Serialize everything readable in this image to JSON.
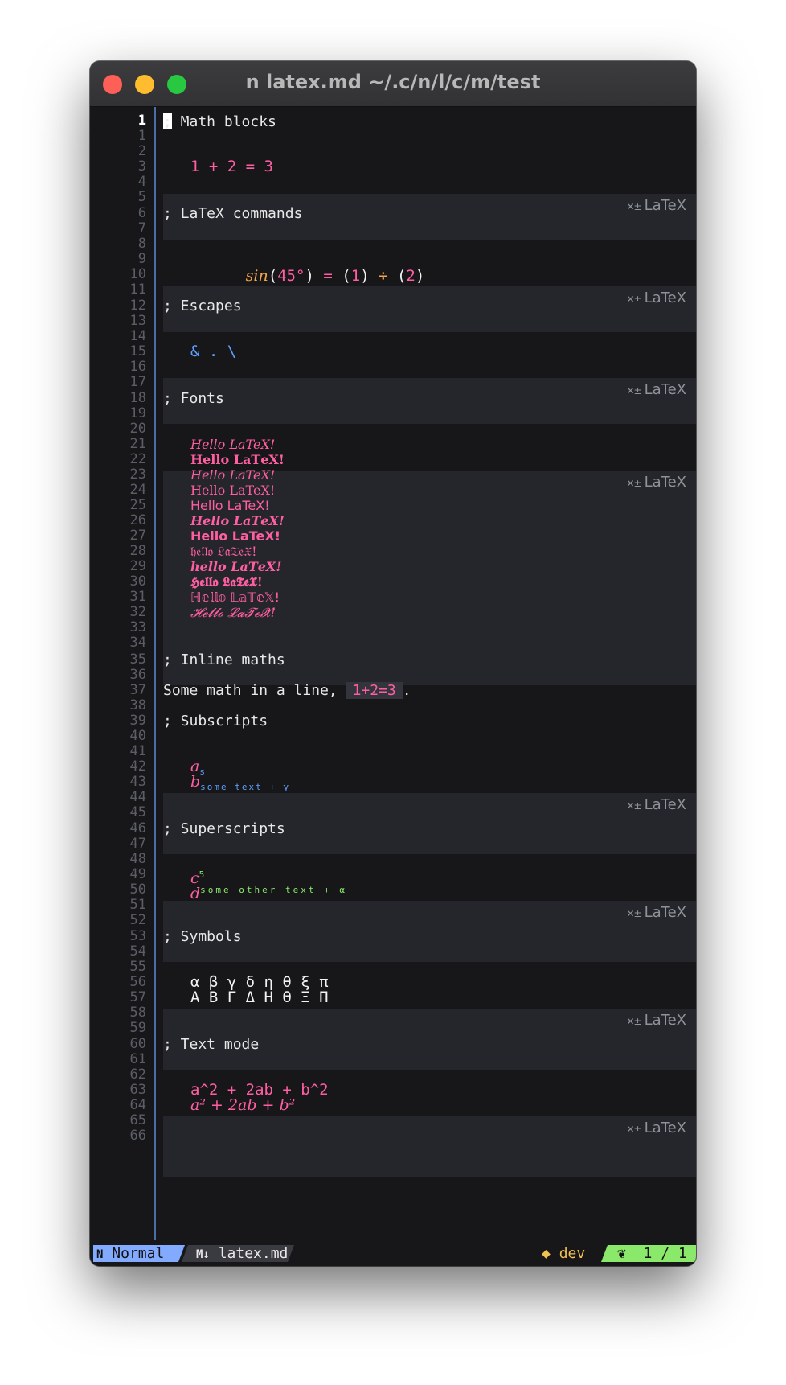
{
  "window": {
    "title": "n latex.md ~/.c/n/l/c/m/test"
  },
  "editor": {
    "line_numbers": [
      "1",
      "1",
      "2",
      "3",
      "4",
      "5",
      "6",
      "7",
      "8",
      "9",
      "10",
      "11",
      "12",
      "13",
      "14",
      "15",
      "16",
      "17",
      "18",
      "19",
      "20",
      "21",
      "22",
      "23",
      "24",
      "25",
      "26",
      "27",
      "28",
      "29",
      "30",
      "31",
      "32",
      "33",
      "34",
      "35",
      "36",
      "37",
      "38",
      "39",
      "40",
      "41",
      "42",
      "43",
      "44",
      "45",
      "46",
      "47",
      "48",
      "49",
      "50",
      "51",
      "52",
      "53",
      "54",
      "55",
      "56",
      "57",
      "58",
      "59",
      "60",
      "61",
      "62",
      "63",
      "64",
      "65",
      "66"
    ],
    "badge_label": "LaTeX",
    "headings": {
      "math_blocks": "; Math blocks",
      "latex_commands": "; LaTeX commands",
      "escapes": "; Escapes",
      "fonts": "; Fonts",
      "inline_maths": "; Inline maths",
      "subscripts": "; Subscripts",
      "superscripts": "; Superscripts",
      "symbols": "; Symbols",
      "text_mode": "; Text mode"
    },
    "math_blocks": {
      "expr": "1 + 2 = 3"
    },
    "latex_commands": {
      "sin": "sin",
      "open1": "(",
      "deg": "45°",
      "close1": ")",
      "eq": " = ",
      "open2": "(",
      "one": "1",
      "close2": ")",
      "div": " ÷ ",
      "open3": "(",
      "two": "2",
      "close3": ")"
    },
    "escapes": {
      "expr": "& . \\"
    },
    "fonts": {
      "lines": [
        "Hello LaTeX!",
        "𝐇𝐞𝐥𝐥𝐨 𝐋𝐚𝐓𝐞𝐗!",
        "Hello LaTeX!",
        "Hello LaTeX!",
        "Hello LaTeX!",
        "𝑯𝒆𝒍𝒍𝒐 𝑳𝒂𝑻𝒆𝑿!",
        "Hello LaTeX!",
        "𝔥𝔢𝔩𝔩𝔬 𝔏𝔞𝔗𝔢𝔛!",
        "𝒉𝒆𝒍𝒍𝒐 𝑳𝒂𝑻𝒆𝑿!",
        "𝕳𝖊𝖑𝖑𝖔 𝕷𝖆𝕿𝖊𝖃!",
        "ℍ𝕖𝕝𝕝𝕠 𝕃𝕒𝕋𝕖𝕏!",
        "𝓗𝓮𝓵𝓵𝓸 𝓛𝓪𝓣𝓮𝓧!"
      ]
    },
    "inline_maths": {
      "prefix": "Some math in a line, ",
      "math": "1+2=3",
      "suffix": "."
    },
    "subscripts": {
      "a_base": "a",
      "a_sub": "s",
      "b_base": "b",
      "b_sub": "some text + γ"
    },
    "superscripts": {
      "c_base": "c",
      "c_sup": "5",
      "d_base": "d",
      "d_sup": "some other text + α"
    },
    "symbols": {
      "lower": "α β γ δ η θ ξ π",
      "upper": "Α Β Γ Δ Η Θ Ξ Π"
    },
    "text_mode": {
      "raw": "a^2 + 2ab + b^2",
      "rendered": "a² + 2ab + b²"
    }
  },
  "statusbar": {
    "mode_icon": "N",
    "mode": "Normal",
    "file_icon": "M↓",
    "file": "latex.md",
    "branch_icon": "◆",
    "branch": "dev",
    "position_icon": "❦",
    "position": "1 / 1"
  },
  "colors": {
    "math_pink": "#ff5fa2",
    "operator_orange": "#f5a54a",
    "escape_blue": "#61a0ff",
    "superscript_green": "#8ae86a",
    "mode_blue": "#82aaff"
  }
}
